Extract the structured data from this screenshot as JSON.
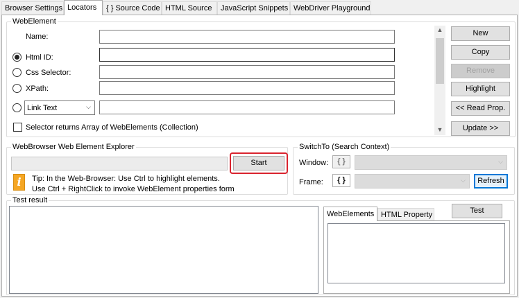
{
  "tabs": [
    {
      "label": "Browser Settings"
    },
    {
      "label": "Locators"
    },
    {
      "label": "{ } Source Code"
    },
    {
      "label": "HTML Source"
    },
    {
      "label": "JavaScript Snippets"
    },
    {
      "label": "WebDriver Playground"
    }
  ],
  "webelement": {
    "legend": "WebElement",
    "name_label": "Name:",
    "name_value": "",
    "html_id_label": "Html ID:",
    "css_label": "Css Selector:",
    "xpath_label": "XPath:",
    "link_select_value": "Link Text",
    "collection_label": "Selector returns Array of WebElements (Collection)",
    "buttons": {
      "new": "New",
      "copy": "Copy",
      "remove": "Remove",
      "highlight": "Highlight",
      "read_prop": "<< Read Prop.",
      "update": "Update >>"
    }
  },
  "explorer": {
    "legend": "WebBrowser Web Element Explorer",
    "start": "Start",
    "tip_line1": "Tip: In the Web-Browser: Use Ctrl to highlight elements.",
    "tip_line2": "Use Ctrl + RightClick to invoke WebElement properties form"
  },
  "switch_to": {
    "legend": "SwitchTo (Search Context)",
    "window_label": "Window:",
    "frame_label": "Frame:",
    "brace": "{ }",
    "refresh": "Refresh"
  },
  "test_result": {
    "legend": "Test result",
    "tabs": [
      {
        "label": "WebElements"
      },
      {
        "label": "HTML Property"
      }
    ],
    "test_button": "Test"
  },
  "colors": {
    "highlight_ring": "#d9232e",
    "focus_border": "#0078d7"
  }
}
